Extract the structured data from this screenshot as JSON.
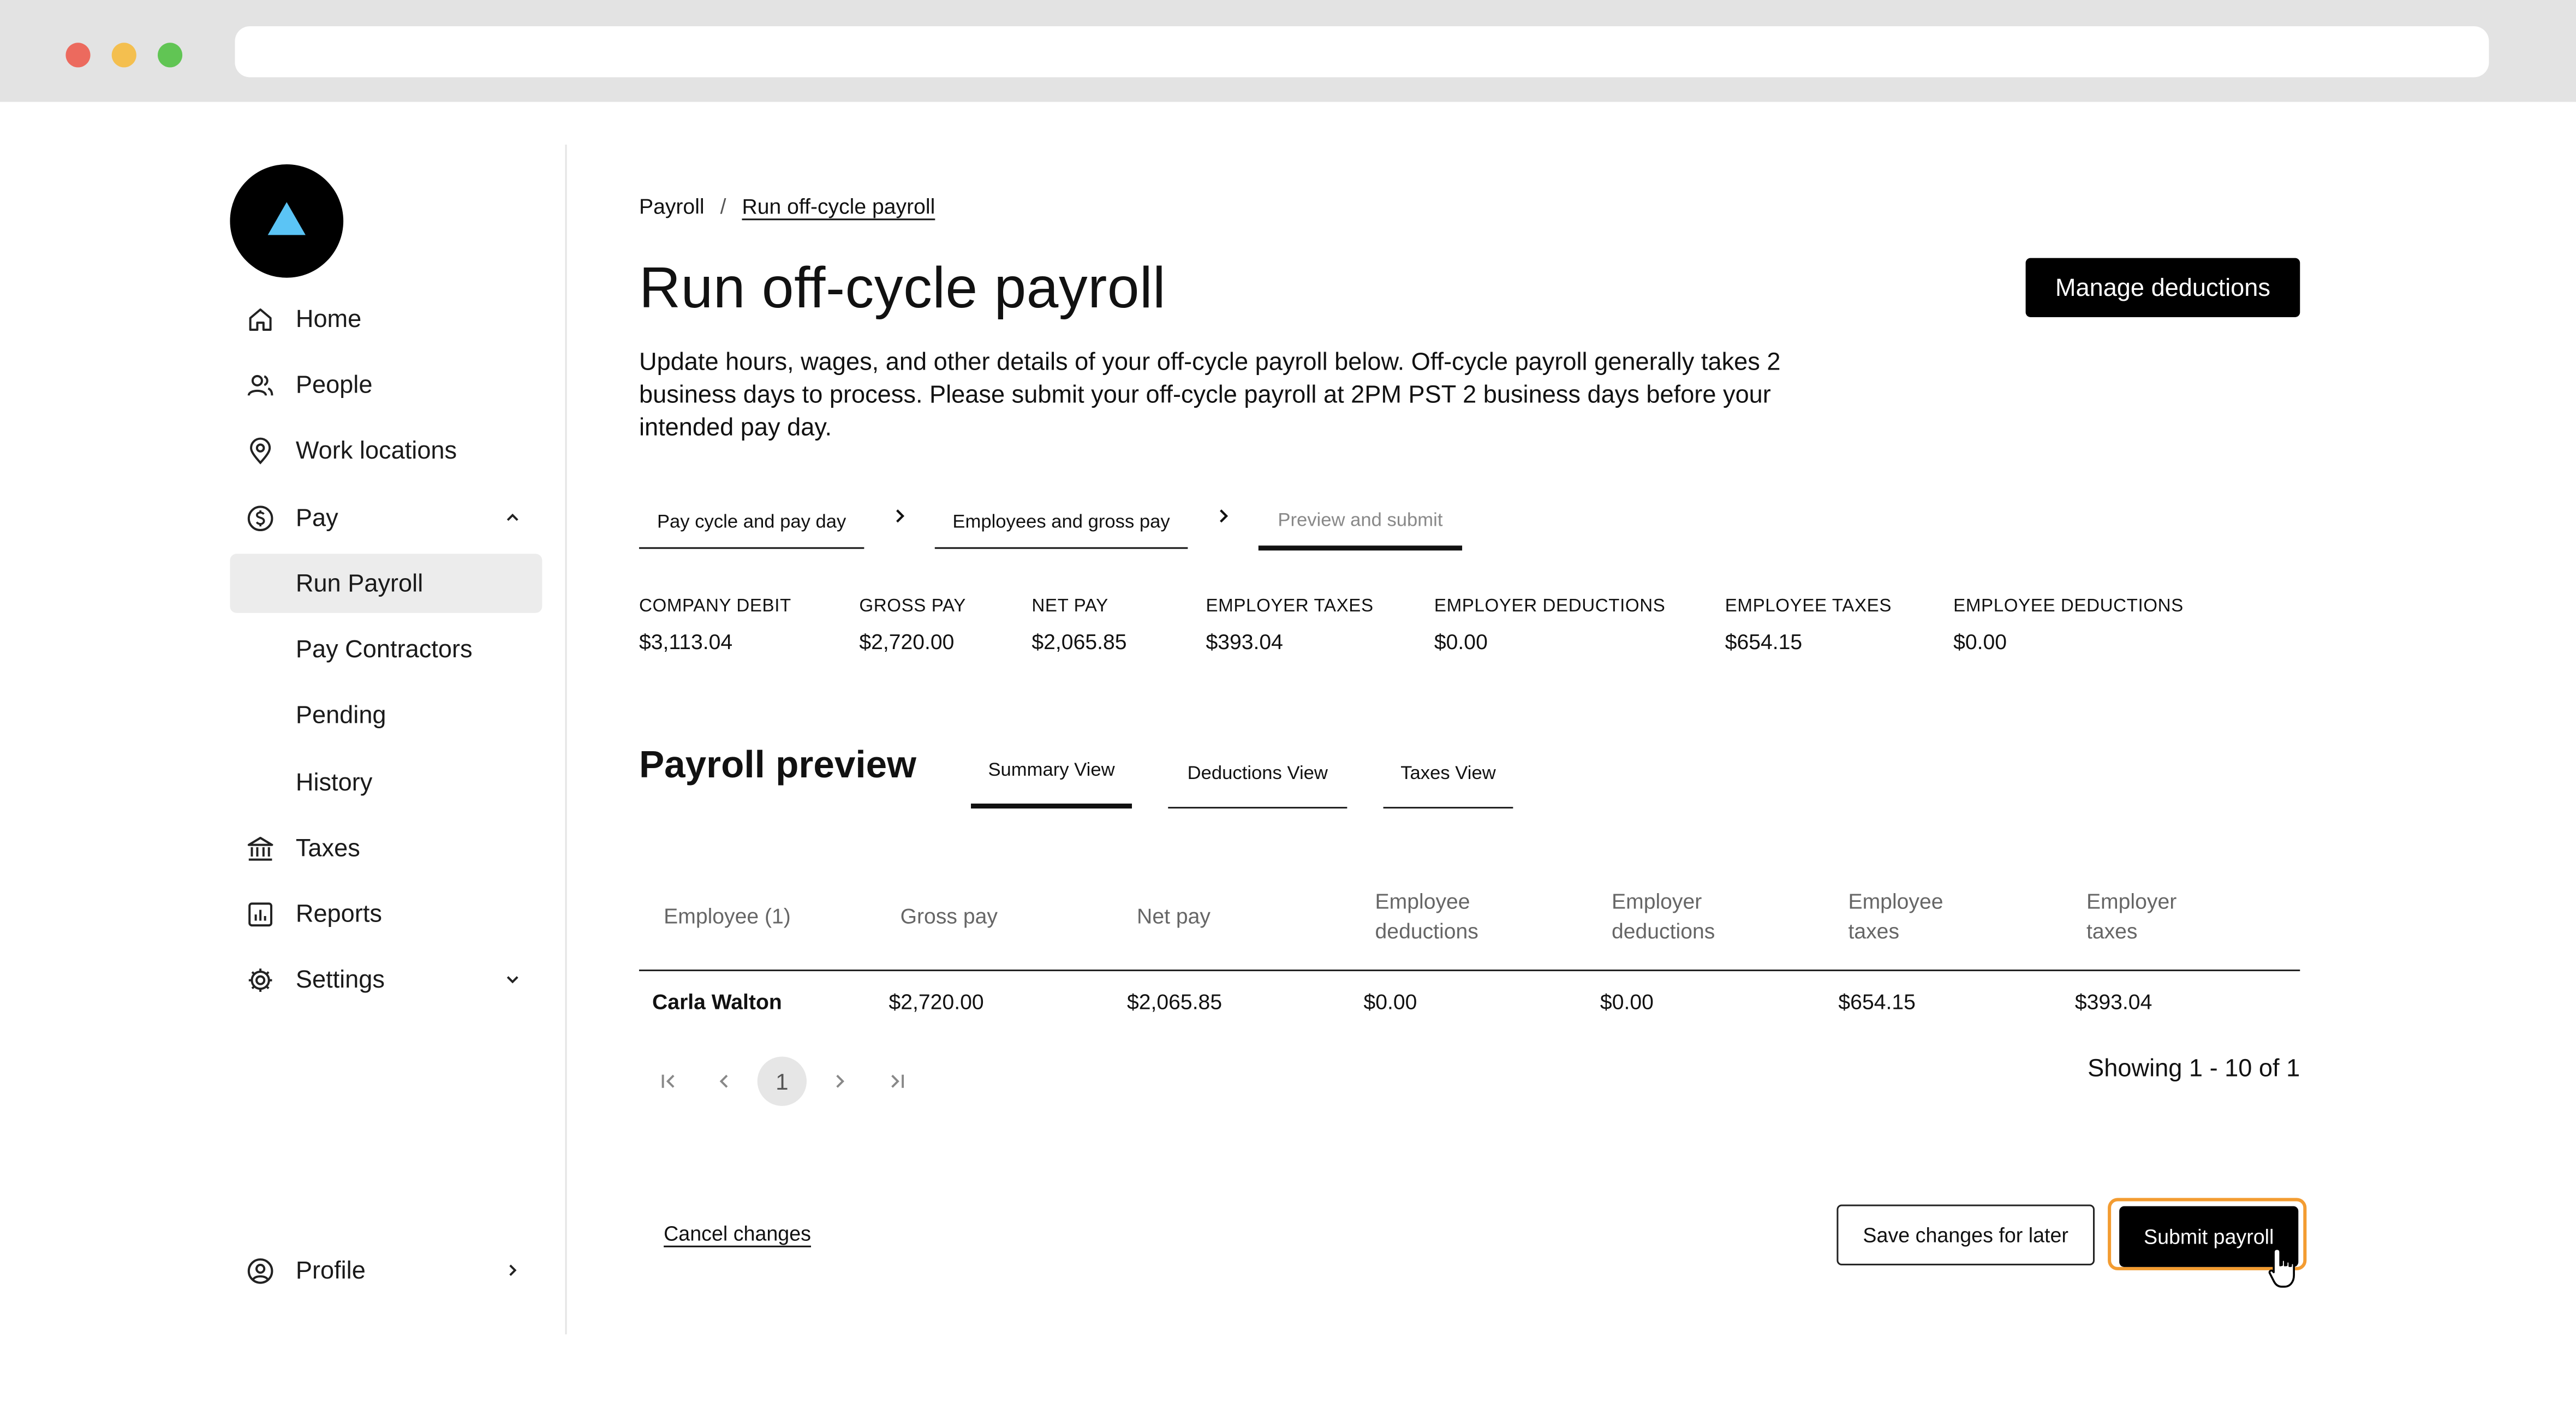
{
  "app": {
    "title": "Run off-cycle payroll"
  },
  "colors": {
    "accent": "#000000",
    "logo_triangle": "#5bc4f5",
    "focus_ring": "#f39c31",
    "traffic_red": "#ec6a5e",
    "traffic_yellow": "#f4bf4f",
    "traffic_green": "#61c554"
  },
  "sidebar": {
    "items": [
      {
        "label": "Home",
        "icon": "home-icon"
      },
      {
        "label": "People",
        "icon": "people-icon"
      },
      {
        "label": "Work locations",
        "icon": "location-pin-icon"
      },
      {
        "label": "Pay",
        "icon": "dollar-circle-icon",
        "expanded": true
      },
      {
        "label": "Run Payroll",
        "active": true
      },
      {
        "label": "Pay Contractors"
      },
      {
        "label": "Pending"
      },
      {
        "label": "History"
      },
      {
        "label": "Taxes",
        "icon": "bank-icon"
      },
      {
        "label": "Reports",
        "icon": "chart-icon"
      },
      {
        "label": "Settings",
        "icon": "gear-icon",
        "expanded": false
      }
    ],
    "profile": {
      "label": "Profile",
      "icon": "user-circle-icon"
    }
  },
  "breadcrumb": {
    "root": "Payroll",
    "separator": "/",
    "current": "Run off-cycle payroll"
  },
  "header": {
    "title": "Run off-cycle payroll",
    "description": "Update hours, wages, and other details of your off-cycle payroll below. Off-cycle payroll generally takes 2 business days to process. Please submit your off-cycle payroll at 2PM PST 2 business days before your intended pay day.",
    "manage_button": "Manage deductions"
  },
  "steps": [
    {
      "label": "Pay cycle and pay day"
    },
    {
      "label": "Employees and gross pay"
    },
    {
      "label": "Preview and submit",
      "current": true
    }
  ],
  "stats": [
    {
      "label": "COMPANY DEBIT",
      "value": "$3,113.04"
    },
    {
      "label": "GROSS PAY",
      "value": "$2,720.00"
    },
    {
      "label": "NET PAY",
      "value": "$2,065.85"
    },
    {
      "label": "EMPLOYER TAXES",
      "value": "$393.04"
    },
    {
      "label": "EMPLOYER DEDUCTIONS",
      "value": "$0.00"
    },
    {
      "label": "EMPLOYEE TAXES",
      "value": "$654.15"
    },
    {
      "label": "EMPLOYEE DEDUCTIONS",
      "value": "$0.00"
    }
  ],
  "preview": {
    "title": "Payroll preview",
    "tabs": [
      {
        "label": "Summary View",
        "active": true
      },
      {
        "label": "Deductions View"
      },
      {
        "label": "Taxes View"
      }
    ],
    "columns": [
      {
        "line1": "Employee (1)",
        "line2": ""
      },
      {
        "line1": "Gross pay",
        "line2": ""
      },
      {
        "line1": "Net pay",
        "line2": ""
      },
      {
        "line1": "Employee",
        "line2": "deductions"
      },
      {
        "line1": "Employer",
        "line2": "deductions"
      },
      {
        "line1": "Employee",
        "line2": "taxes"
      },
      {
        "line1": "Employer",
        "line2": "taxes"
      }
    ],
    "rows": [
      [
        "Carla Walton",
        "$2,720.00",
        "$2,065.85",
        "$0.00",
        "$0.00",
        "$654.15",
        "$393.04"
      ]
    ]
  },
  "pagination": {
    "current_page": "1",
    "showing": "Showing 1 - 10 of 1"
  },
  "actions": {
    "cancel": "Cancel changes",
    "save": "Save changes for later",
    "submit": "Submit payroll"
  }
}
